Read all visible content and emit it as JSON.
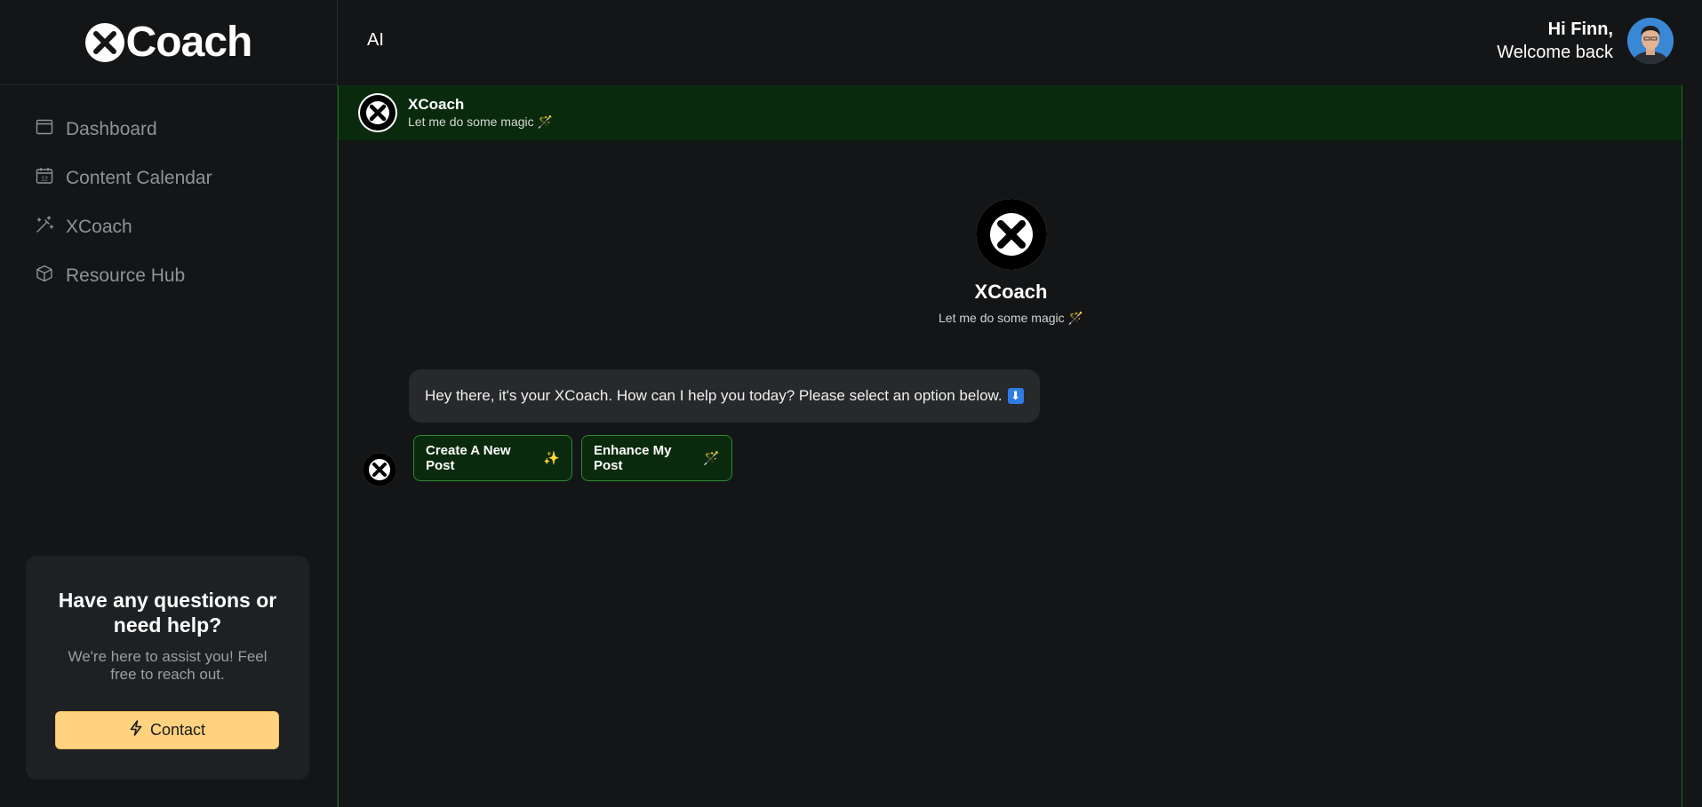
{
  "brand": {
    "logo_text": "Coach"
  },
  "sidebar": {
    "items": [
      {
        "label": "Dashboard",
        "icon": "layout-icon"
      },
      {
        "label": "Content Calendar",
        "icon": "calendar-icon"
      },
      {
        "label": "XCoach",
        "icon": "magic-wand-icon"
      },
      {
        "label": "Resource Hub",
        "icon": "cube-icon"
      }
    ],
    "help": {
      "title": "Have any questions or need help?",
      "subtitle": "We're here to assist you! Feel free to reach out.",
      "button_label": "Contact"
    }
  },
  "header": {
    "title": "AI",
    "greeting_line1": "Hi Finn,",
    "greeting_line2": "Welcome back"
  },
  "chat": {
    "bot_name": "XCoach",
    "bot_tagline": "Let me do some magic 🪄",
    "message": "Hey there, it's your XCoach. How can I help you today? Please select an option below.",
    "message_emoji": "⬇",
    "options": [
      {
        "label": "Create A New Post",
        "emoji": "✨"
      },
      {
        "label": "Enhance My Post",
        "emoji": "🪄"
      }
    ]
  },
  "colors": {
    "background": "#141516",
    "chat_header": "#0a2a0d",
    "accent_green": "#2c8a31",
    "contact_button": "#ffd27f"
  }
}
